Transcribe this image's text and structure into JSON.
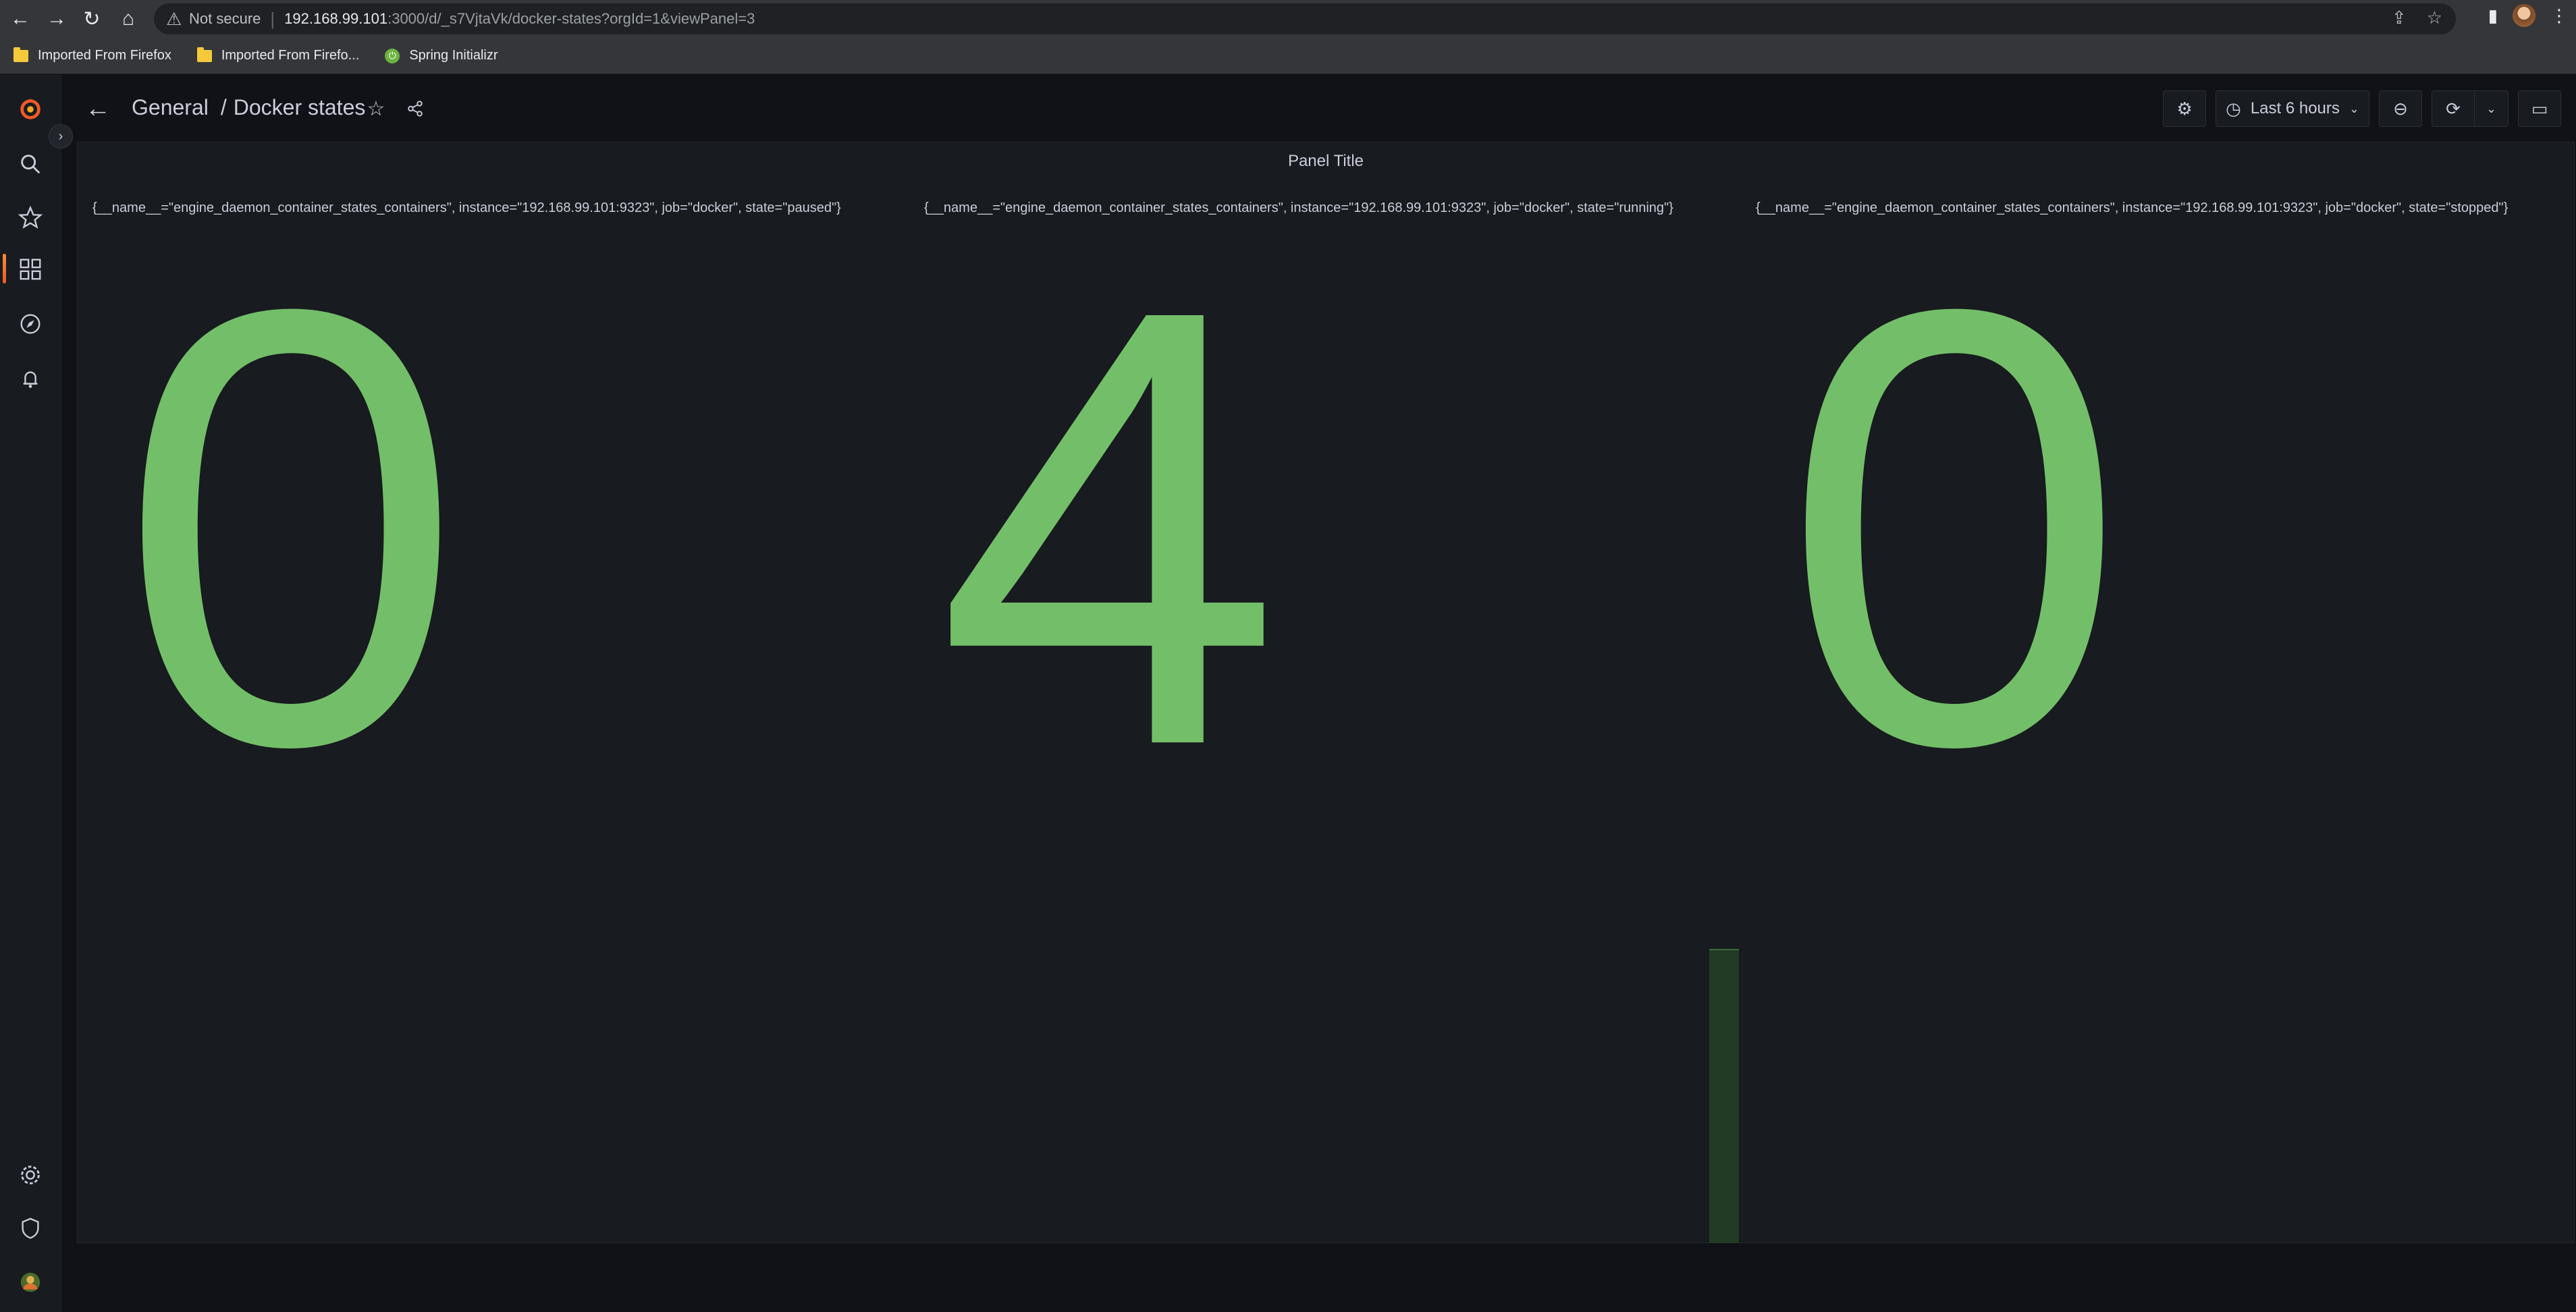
{
  "browser": {
    "security_label": "Not secure",
    "url_host": "192.168.99.101",
    "url_path": ":3000/d/_s7VjtaVk/docker-states?orgId=1&viewPanel=3",
    "bookmarks": [
      {
        "label": "Imported From Firefox",
        "icon": "folder-icon"
      },
      {
        "label": "Imported From Firefo...",
        "icon": "folder-icon"
      },
      {
        "label": "Spring Initializr",
        "icon": "spring-icon"
      }
    ]
  },
  "header": {
    "folder": "General",
    "separator": "/",
    "dashboard": "Docker states",
    "time_range": "Last 6 hours"
  },
  "panel": {
    "title": "Panel Title",
    "stats": [
      {
        "label": "{__name__=\"engine_daemon_container_states_containers\", instance=\"192.168.99.101:9323\", job=\"docker\", state=\"paused\"}",
        "value": "0"
      },
      {
        "label": "{__name__=\"engine_daemon_container_states_containers\", instance=\"192.168.99.101:9323\", job=\"docker\", state=\"running\"}",
        "value": "4"
      },
      {
        "label": "{__name__=\"engine_daemon_container_states_containers\", instance=\"192.168.99.101:9323\", job=\"docker\", state=\"stopped\"}",
        "value": "0"
      }
    ]
  },
  "colors": {
    "stat_value": "#73bf69",
    "grafana_orange": "#f05a28",
    "panel_bg": "#181b1f",
    "page_bg": "#111217"
  }
}
